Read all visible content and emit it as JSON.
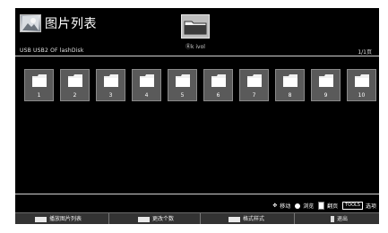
{
  "header": {
    "title": "图片列表",
    "folder_name": "Ⓑk ivol",
    "device_path": "USB USB2 OF lashDisk",
    "page_counter": "1/1页"
  },
  "tiles": [
    "1",
    "2",
    "3",
    "4",
    "5",
    "6",
    "7",
    "8",
    "9",
    "10"
  ],
  "hint_bar": {
    "move_label": "移动",
    "ok_label": "浏览",
    "page_label": "翻页",
    "tools_key": "TOOLS",
    "tools_label": "选项"
  },
  "buttons": [
    {
      "label": "播放图片列表",
      "swatch": "#e8e8e8"
    },
    {
      "label": "更改个数",
      "swatch": "#e8e8e8"
    },
    {
      "label": "格式样式",
      "swatch": "#e8e8e8"
    },
    {
      "label": "退出",
      "icon": "exit-icon"
    }
  ],
  "colors": {
    "background": "#000000",
    "tile": "#5a5a5a",
    "button_bar": "#333333"
  },
  "icons": {
    "app_icon": "picture-icon",
    "folder_icon": "folder-icon",
    "move_icon": "dpad-icon",
    "ok_icon": "ok-icon"
  }
}
